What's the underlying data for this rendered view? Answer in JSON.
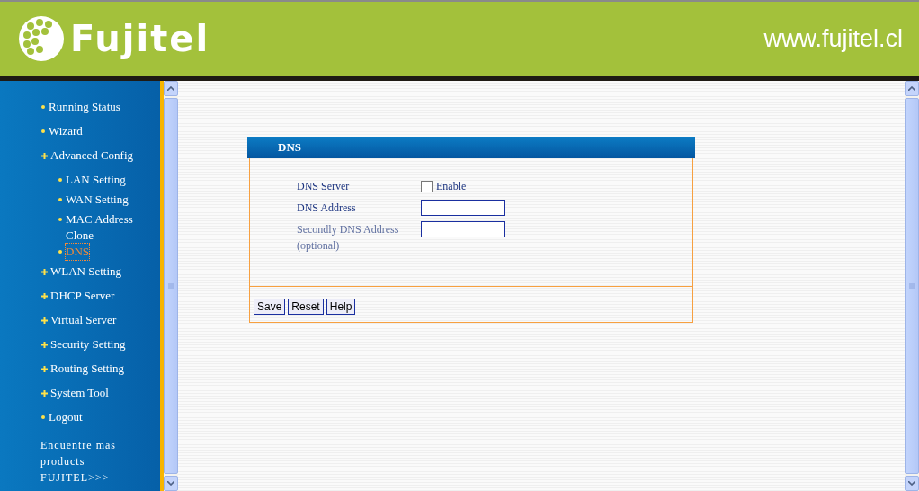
{
  "header": {
    "logo": "Fujitel",
    "url": "www.fujitel.cl"
  },
  "sidebar": {
    "items": [
      {
        "label": "Running Status",
        "kind": "bullet",
        "selected": false
      },
      {
        "label": "Wizard",
        "kind": "bullet",
        "selected": false
      },
      {
        "label": "Advanced Config",
        "kind": "plus",
        "selected": false,
        "children": [
          {
            "label": "LAN Setting",
            "kind": "bullet",
            "selected": false
          },
          {
            "label": "WAN Setting",
            "kind": "bullet",
            "selected": false
          },
          {
            "label": "MAC Address Clone",
            "kind": "bullet",
            "selected": false
          },
          {
            "label": "DNS",
            "kind": "bullet",
            "selected": true
          }
        ]
      },
      {
        "label": "WLAN Setting",
        "kind": "plus",
        "selected": false
      },
      {
        "label": "DHCP Server",
        "kind": "plus",
        "selected": false
      },
      {
        "label": "Virtual Server",
        "kind": "plus",
        "selected": false
      },
      {
        "label": "Security Setting",
        "kind": "plus",
        "selected": false
      },
      {
        "label": "Routing Setting",
        "kind": "plus",
        "selected": false
      },
      {
        "label": "System Tool",
        "kind": "plus",
        "selected": false
      },
      {
        "label": "Logout",
        "kind": "bullet",
        "selected": false
      }
    ],
    "footer": "Encuentre mas products FUJITEL>>>"
  },
  "panel": {
    "title": "DNS",
    "rows": [
      {
        "label": "DNS Server",
        "kind": "checkbox",
        "checked": false,
        "option": "Enable"
      },
      {
        "label": "DNS Address",
        "kind": "input"
      },
      {
        "label": "Secondly DNS Address (optional)",
        "kind": "input"
      }
    ],
    "buttons": [
      "Save",
      "Reset",
      "Help"
    ]
  }
}
